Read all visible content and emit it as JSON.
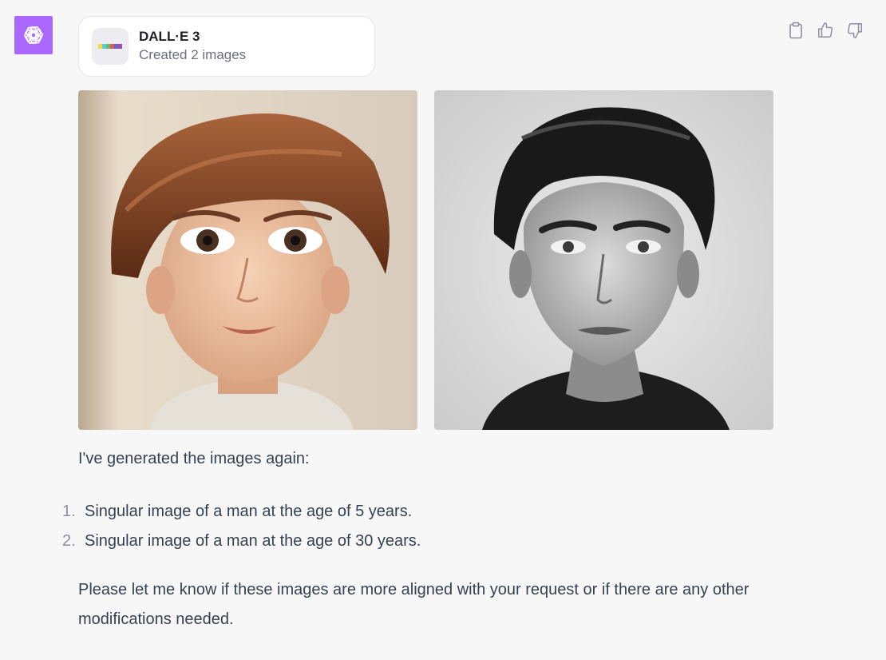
{
  "assistant": {
    "avatar_icon": "openai-logo-icon",
    "avatar_color": "#ab68ff"
  },
  "tool_card": {
    "title": "DALL·E 3",
    "subtitle": "Created 2 images",
    "icon": "dalle-color-strip-icon",
    "strip_colors": [
      "#fdd835",
      "#4dd0e1",
      "#66bb6a",
      "#ef5350",
      "#5c6bc0",
      "#ab47bc"
    ]
  },
  "actions": [
    {
      "icon": "clipboard-icon"
    },
    {
      "icon": "thumbs-up-icon"
    },
    {
      "icon": "thumbs-down-icon"
    }
  ],
  "images": [
    {
      "subject": "generated-portrait-child"
    },
    {
      "subject": "generated-portrait-adult"
    }
  ],
  "message": {
    "intro": "I've generated the images again:",
    "items": [
      {
        "number": "1.",
        "text": "Singular image of a man at the age of 5 years."
      },
      {
        "number": "2.",
        "text": "Singular image of a man at the age of 30 years."
      }
    ],
    "closing": "Please let me know if these images are more aligned with your request or if there are any other modifications needed."
  }
}
